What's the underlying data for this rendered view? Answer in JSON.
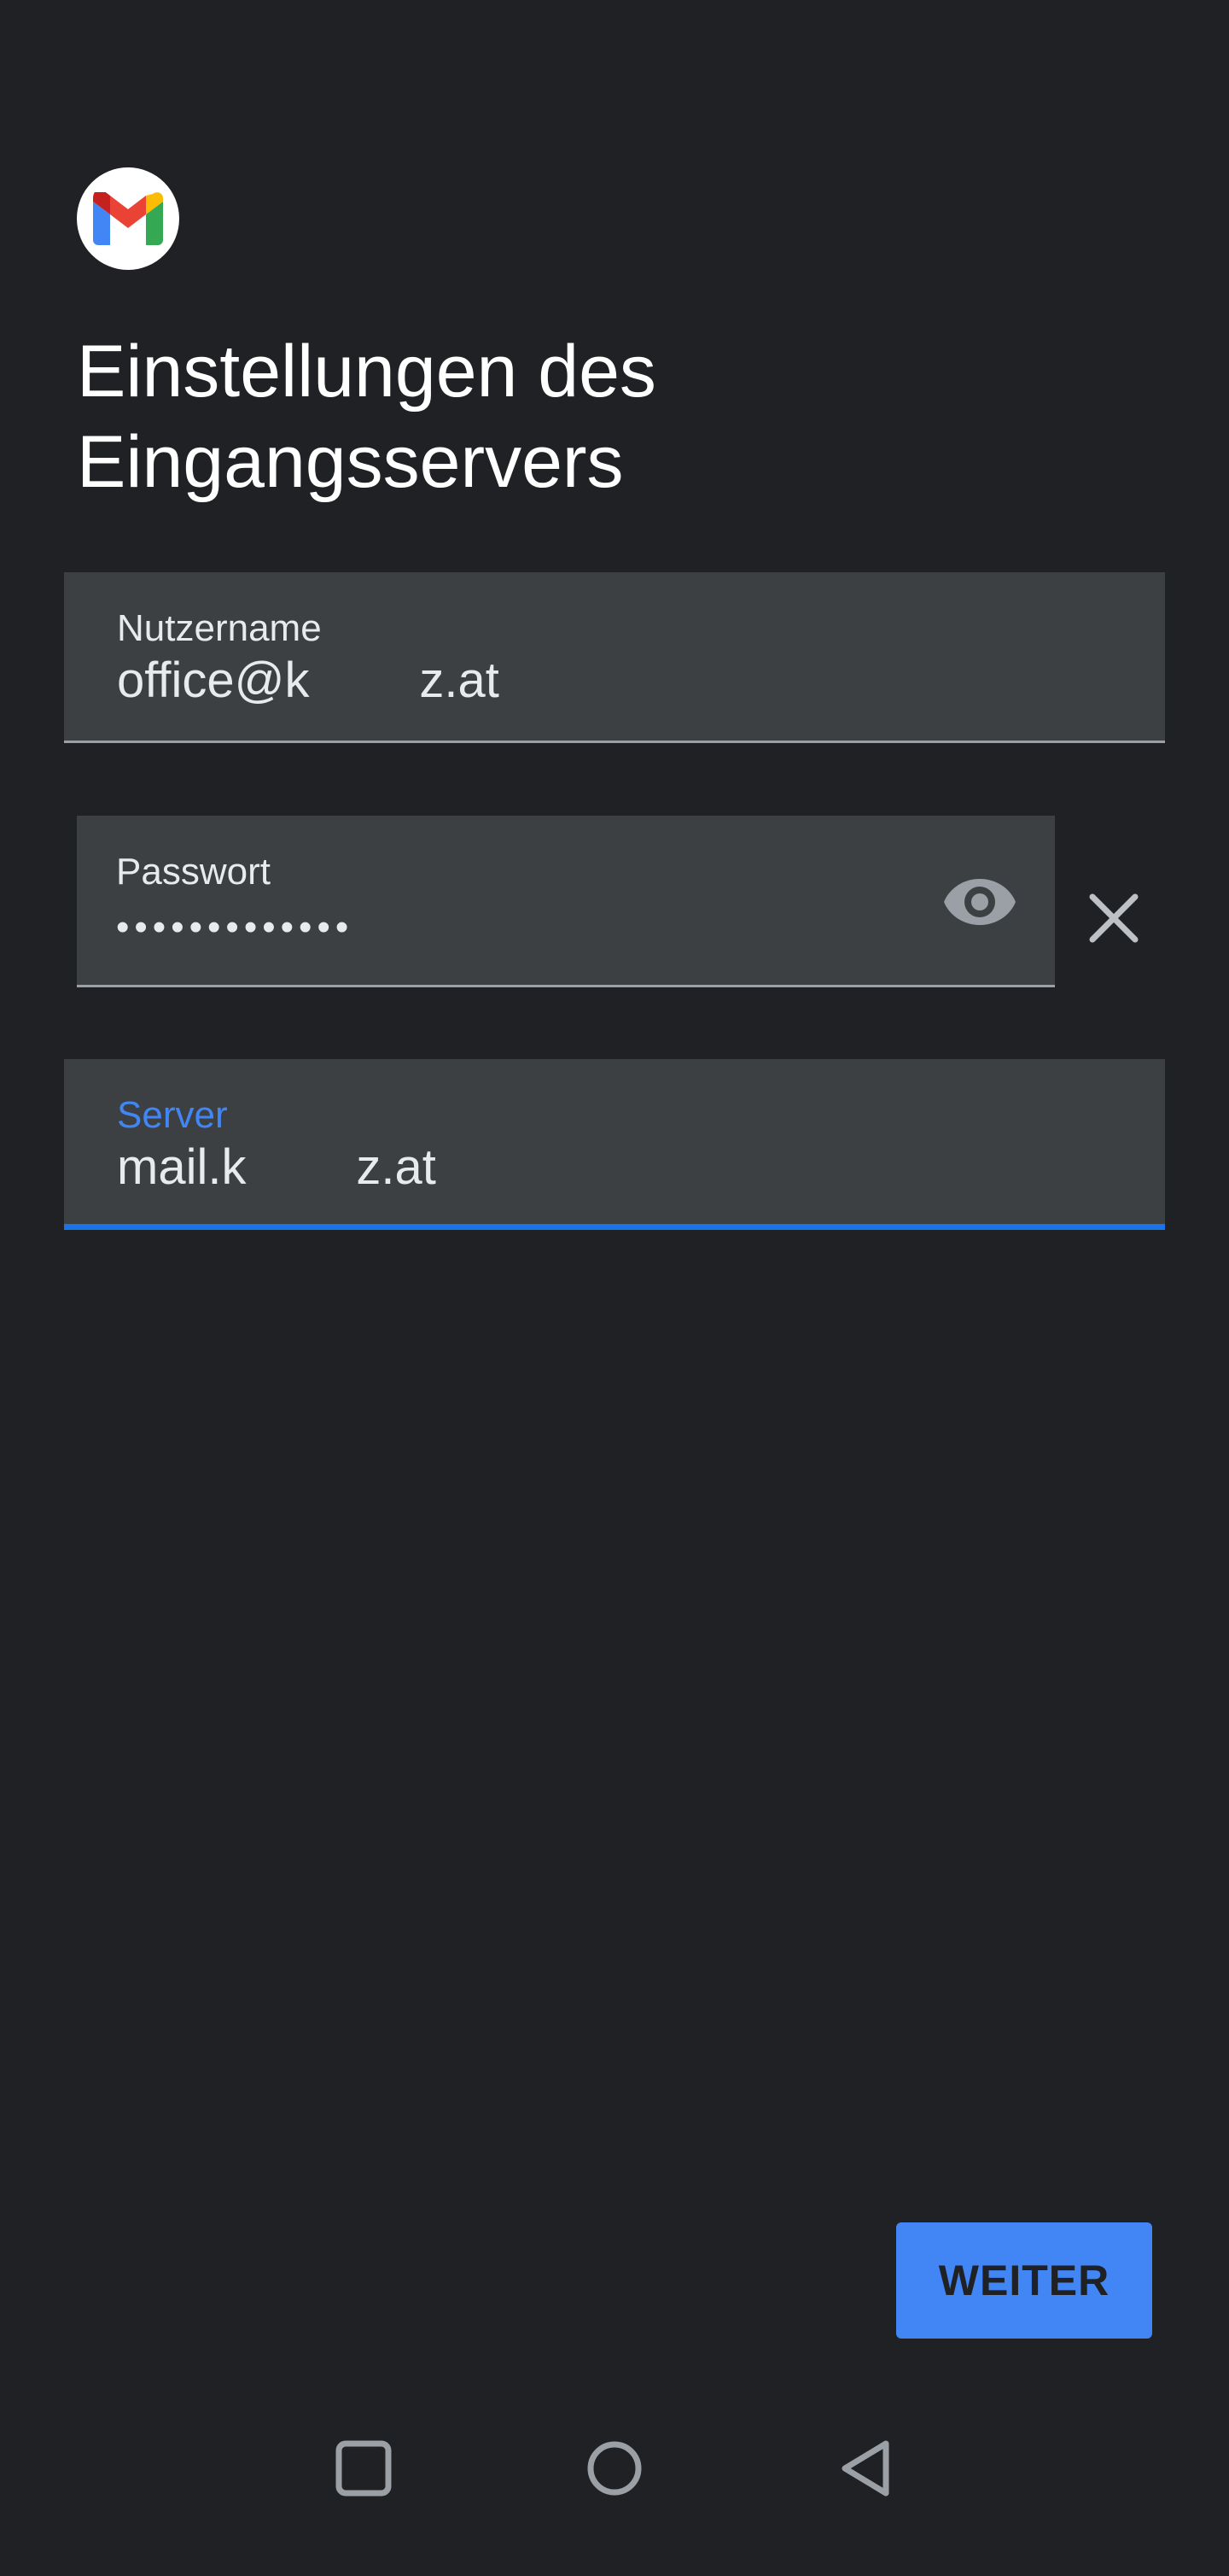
{
  "app": {
    "logo_icon": "gmail-logo-icon"
  },
  "page": {
    "title_line1": "Einstellungen des",
    "title_line2": "Eingangsservers"
  },
  "fields": {
    "username": {
      "label": "Nutzername",
      "value": "office@k        z.at"
    },
    "password": {
      "label": "Passwort",
      "value": "•••••••••••••",
      "show_icon": "eye-icon"
    },
    "server": {
      "label": "Server",
      "value": "mail.k        z.at",
      "focused": true
    }
  },
  "actions": {
    "next_label": "WEITER",
    "clear_icon": "close-icon"
  },
  "navigation": {
    "recents_icon": "square-icon",
    "home_icon": "circle-icon",
    "back_icon": "triangle-back-icon"
  },
  "colors": {
    "background": "#202124",
    "field_bg": "#3c4043",
    "accent": "#4285f4",
    "focus_underline": "#1a73e8"
  }
}
